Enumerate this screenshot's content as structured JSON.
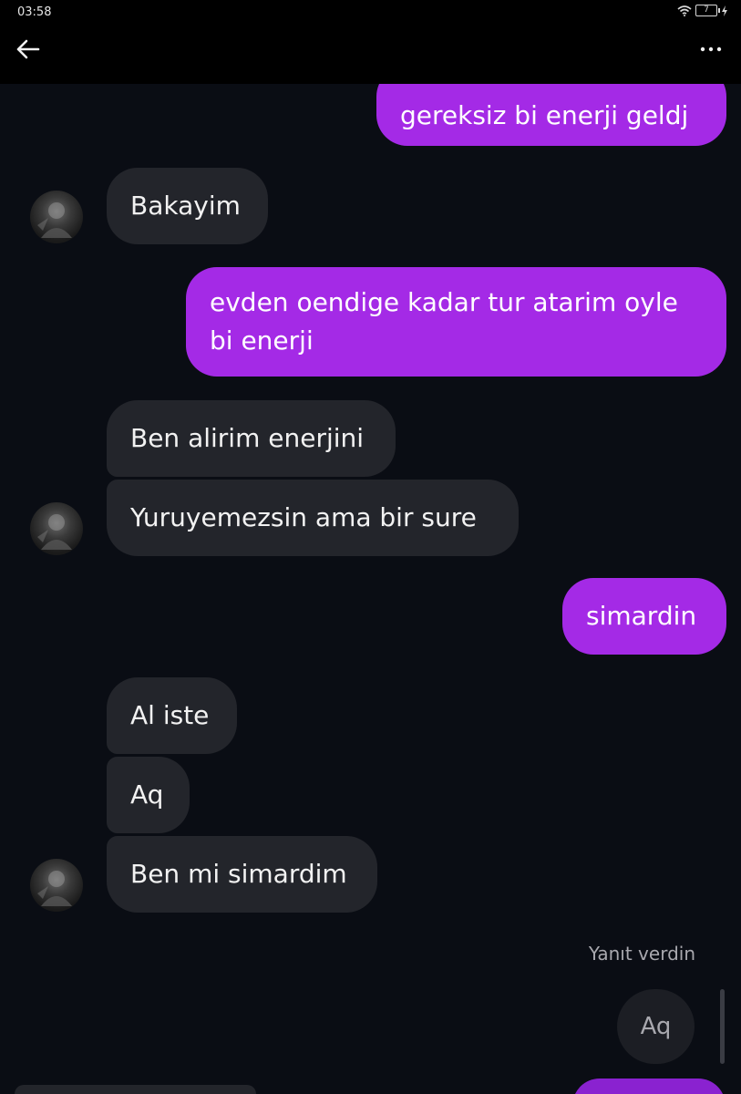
{
  "status_bar": {
    "time": "03:58",
    "battery": "7",
    "icons": [
      "wifi-icon",
      "battery-icon",
      "charging-icon"
    ]
  },
  "header": {
    "back_icon": "arrow-left-icon",
    "more_icon": "more-dots-icon",
    "more_glyph": "···"
  },
  "messages": [
    {
      "from": "me",
      "text": "gereksiz bi enerji geldj"
    },
    {
      "from": "them",
      "text": "Bakayim"
    },
    {
      "from": "me",
      "lines": [
        "evden oendige kadar tur atarim oyle",
        "bi enerji"
      ]
    },
    {
      "from": "them",
      "text": "Ben alirim enerjini"
    },
    {
      "from": "them",
      "text": "Yuruyemezsin ama bir sure"
    },
    {
      "from": "me",
      "text": "simardin"
    },
    {
      "from": "them",
      "text": "Al iste"
    },
    {
      "from": "them",
      "text": "Aq"
    },
    {
      "from": "them",
      "text": "Ben mi simardim"
    }
  ],
  "reply": {
    "label": "Yanıt verdin",
    "quoted_text": "Aq"
  },
  "colors": {
    "sent_bubble": "#a42ae6",
    "received_bubble": "#23252b",
    "chat_background": "#0a0d14",
    "top_bar": "#000000"
  }
}
